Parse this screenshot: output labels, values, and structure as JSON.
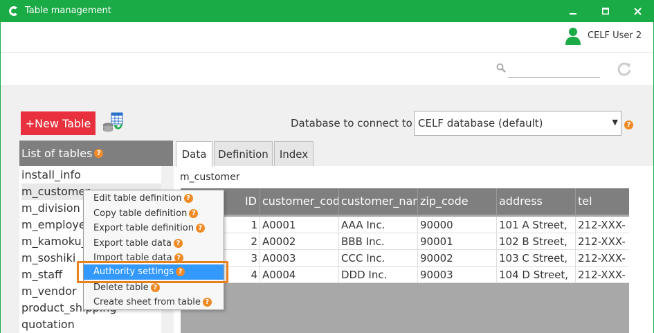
{
  "window": {
    "title": "Table management",
    "user": "CELF User 2"
  },
  "colors": {
    "titlebar": "#1aaa46",
    "new_table_button": "#e8303e",
    "highlight": "#3399ff",
    "outline": "#e8801e",
    "help_icon": "#f08a24"
  },
  "search": {
    "placeholder": ""
  },
  "toolbar": {
    "new_table_label": "+New Table",
    "db_label": "Database to connect to",
    "db_selected": "CELF database (default)"
  },
  "tables_panel": {
    "header": "List of tables",
    "items": [
      "install_info",
      "m_customer",
      "m_division",
      "m_employee",
      "m_kamoku_",
      "m_soshiki",
      "m_staff",
      "m_vendor",
      "product_shipping",
      "quotation"
    ]
  },
  "tabs": [
    "Data",
    "Definition",
    "Index"
  ],
  "current_table": "m_customer",
  "grid": {
    "columns": [
      "ID",
      "customer_code",
      "customer_name",
      "zip_code",
      "address",
      "tel"
    ],
    "rows": [
      [
        "1",
        "A0001",
        "AAA Inc.",
        "90000",
        "101 A Street,",
        "212-XXX-"
      ],
      [
        "2",
        "A0002",
        "BBB Inc.",
        "90001",
        "102 B Street,",
        "212-XXX-"
      ],
      [
        "3",
        "A0003",
        "CCC Inc.",
        "90002",
        "103 C Street,",
        "212-XXX-"
      ],
      [
        "4",
        "A0004",
        "DDD Inc.",
        "90003",
        "104 D Street,",
        "212-XXX-"
      ]
    ]
  },
  "context_menu": {
    "items": [
      "Edit table definition",
      "Copy table definition",
      "Export table definition",
      "Export table data",
      "Import table data",
      "Authority settings",
      "Delete table",
      "Create sheet from table"
    ]
  },
  "help_mark": "?"
}
